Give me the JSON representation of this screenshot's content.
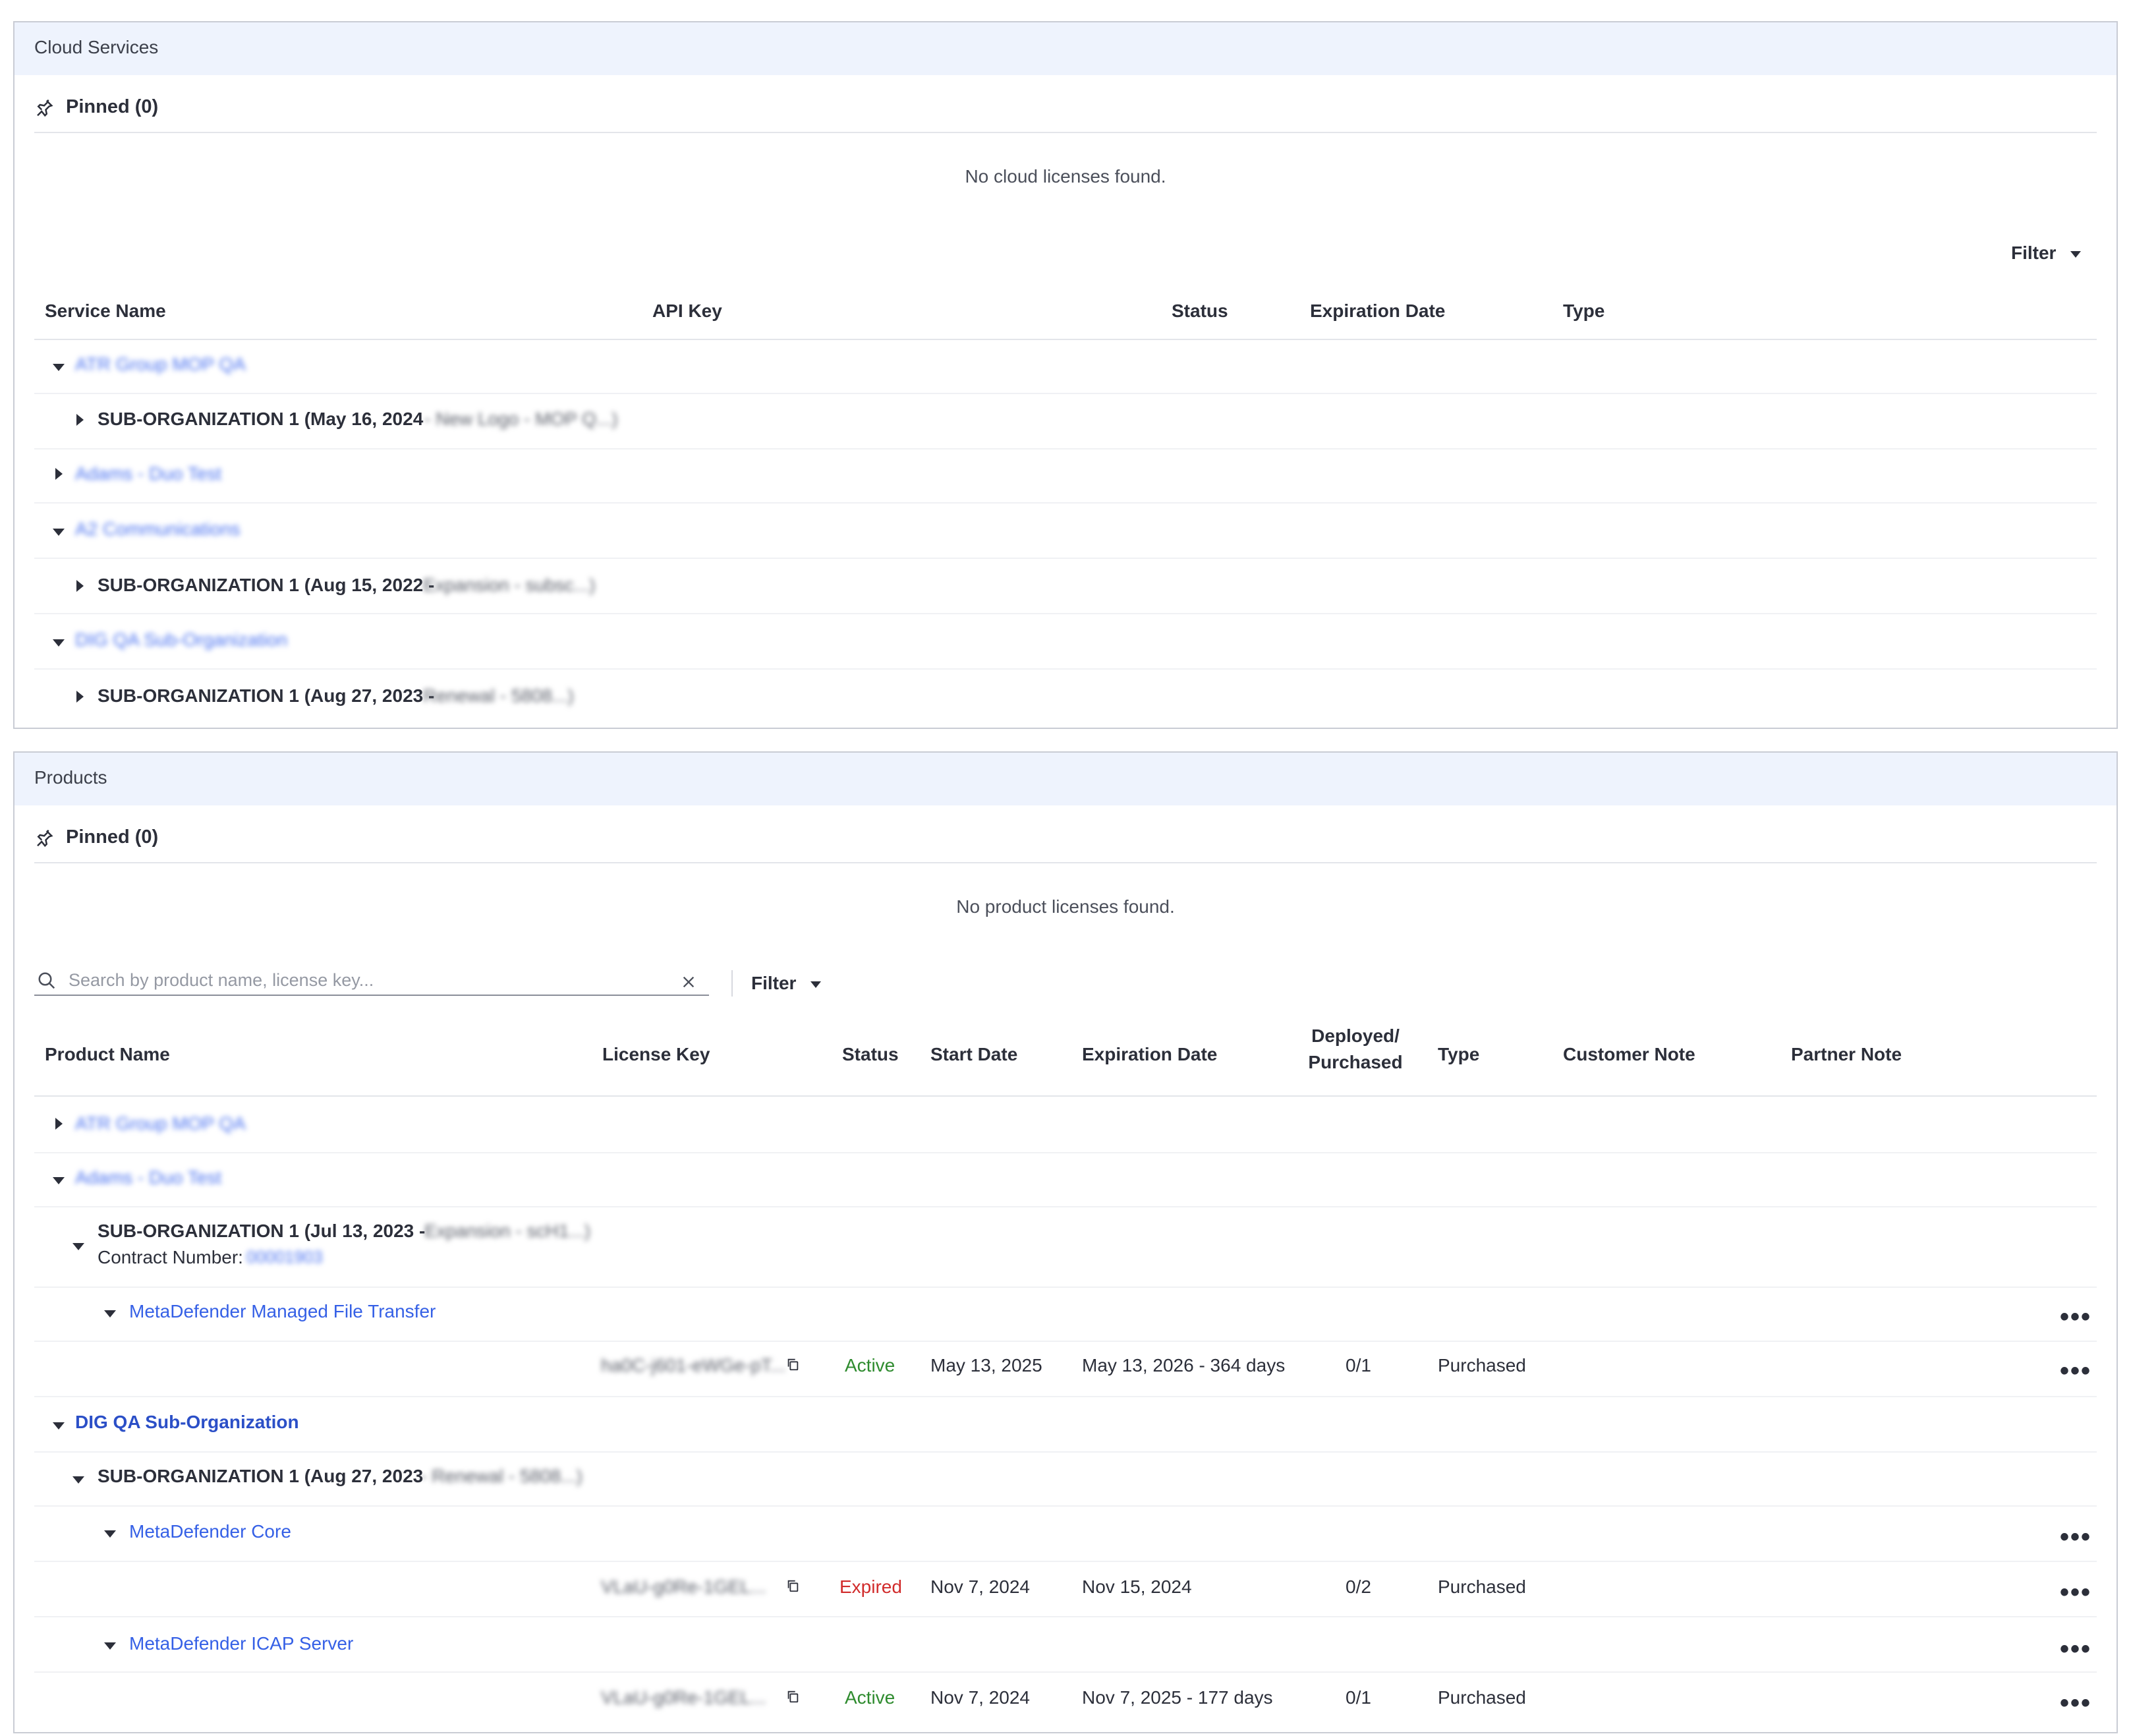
{
  "cloud": {
    "title": "Cloud Services",
    "pinned": "Pinned (0)",
    "empty": "No cloud licenses found.",
    "filter": "Filter",
    "columns": {
      "service_name": "Service Name",
      "api_key": "API Key",
      "status": "Status",
      "expiration_date": "Expiration Date",
      "type": "Type"
    },
    "rows": [
      {
        "kind": "org",
        "name": "ATR Group MOP QA",
        "expanded": true
      },
      {
        "kind": "sub",
        "label": "SUB-ORGANIZATION 1 (May 16, 2024",
        "hidden": " - New Logo - MOP Q...)"
      },
      {
        "kind": "org",
        "name": "Adams - Duo Test",
        "expanded": false
      },
      {
        "kind": "org",
        "name": "A2 Communications",
        "expanded": true
      },
      {
        "kind": "sub",
        "label": "SUB-ORGANIZATION 1 (Aug 15, 2022 - ",
        "hidden": "Expansion - subsc...)"
      },
      {
        "kind": "org",
        "name": "DIG QA Sub-Organization",
        "expanded": true
      },
      {
        "kind": "sub",
        "label": "SUB-ORGANIZATION 1 (Aug 27, 2023 - ",
        "hidden": "Renewal - 5808...)"
      }
    ]
  },
  "products": {
    "title": "Products",
    "pinned": "Pinned (0)",
    "empty": "No product licenses found.",
    "search_placeholder": "Search by product name, license key...",
    "filter": "Filter",
    "columns": {
      "product_name": "Product Name",
      "license_key": "License Key",
      "status": "Status",
      "start_date": "Start Date",
      "expiration_date": "Expiration Date",
      "deployed_line1": "Deployed/",
      "deployed_line2": "Purchased",
      "type": "Type",
      "customer_note": "Customer Note",
      "partner_note": "Partner Note"
    },
    "org1": {
      "name": "ATR Group MOP QA"
    },
    "org2": {
      "name": "Adams - Duo Test",
      "sub": {
        "label": "SUB-ORGANIZATION 1 (Jul 13, 2023 - ",
        "hidden": "Expansion - scH1...)",
        "contract_label": "Contract Number:",
        "contract_value": "00001903"
      },
      "product": {
        "name": "MetaDefender Managed File Transfer",
        "license": {
          "key": "ha0C-j601-eWGe-pT...",
          "status": "Active",
          "start": "May 13, 2025",
          "expiration": "May 13, 2026 - 364 days",
          "deployed": "0/1",
          "type": "Purchased"
        }
      }
    },
    "org3": {
      "name": "DIG QA Sub-Organization",
      "sub": {
        "label": "SUB-ORGANIZATION 1 (Aug 27, 2023",
        "hidden": " - Renewal - 5808...)"
      },
      "product_core": {
        "name": "MetaDefender Core",
        "license": {
          "key": "VLaU-g0Re-1GEL...",
          "status": "Expired",
          "start": "Nov 7, 2024",
          "expiration": "Nov 15, 2024",
          "deployed": "0/2",
          "type": "Purchased"
        }
      },
      "product_icap": {
        "name": "MetaDefender ICAP Server",
        "license": {
          "key": "VLaU-g0Re-1GEL...",
          "status": "Active",
          "start": "Nov 7, 2024",
          "expiration": "Nov 7, 2025 - 177 days",
          "deployed": "0/1",
          "type": "Purchased"
        }
      }
    },
    "more_label": "•••",
    "status_colors": {
      "active": "#2e8b2e",
      "expired": "#d12b2b"
    }
  },
  "icons": [
    "pin-icon",
    "chevron-down-icon",
    "chevron-right-icon",
    "search-icon",
    "close-icon",
    "copy-icon",
    "more-icon"
  ]
}
